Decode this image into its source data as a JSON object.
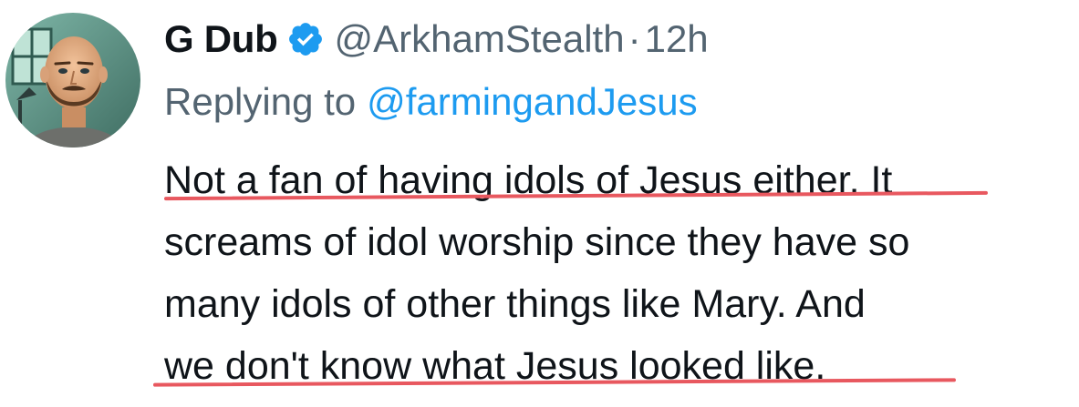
{
  "author": {
    "display_name": "G Dub",
    "handle": "@ArkhamStealth",
    "separator": "·",
    "time": "12h",
    "verified": true
  },
  "reply": {
    "label": "Replying to",
    "handle": "@farmingandJesus"
  },
  "body": {
    "lines": [
      "Not a fan of having idols of Jesus either. It",
      "screams of idol worship since they have so",
      "many idols of other things like Mary. And",
      "we don't know what Jesus looked like."
    ]
  },
  "colors": {
    "name": "#0f1419",
    "secondary": "#536471",
    "link": "#1d9bf0",
    "verified_badge": "#1d9bf0",
    "annotation_underline": "#e8585f"
  },
  "icons": {
    "verified": "verified-badge-icon",
    "avatar": "profile-avatar-illustration"
  }
}
